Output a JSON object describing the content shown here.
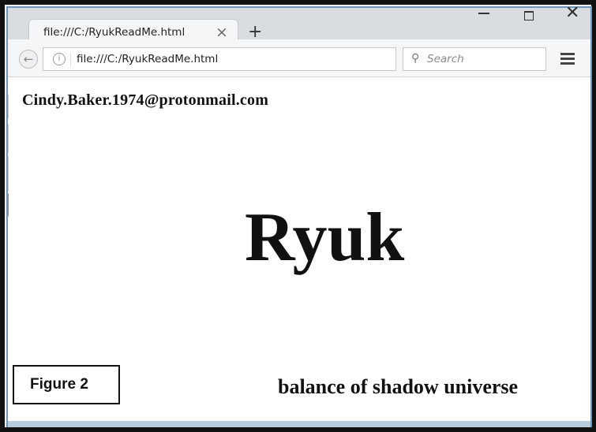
{
  "browser": {
    "tab_title": "file:///C:/RyukReadMe.html",
    "tab_close_glyph": "×",
    "new_tab_glyph": "+",
    "address": "file:///C:/RyukReadMe.html",
    "search_placeholder": "Search",
    "icons": {
      "back": "back-arrow-icon",
      "info": "info-icon",
      "reload": "reload-icon",
      "search": "search-icon",
      "menu": "hamburger-menu-icon",
      "minimize": "minimize-icon",
      "maximize": "maximize-icon",
      "close": "close-window-icon"
    }
  },
  "page": {
    "email": "Cindy.Baker.1974@protonmail.com",
    "heading": "Ryuk",
    "tagline": "balance of shadow universe"
  },
  "figure": {
    "label": "Figure 2"
  },
  "colors": {
    "frame": "#111111",
    "window_border": "#6f95b8",
    "toolbar": "#f5f6f7",
    "tabstrip": "#d9dde2"
  }
}
